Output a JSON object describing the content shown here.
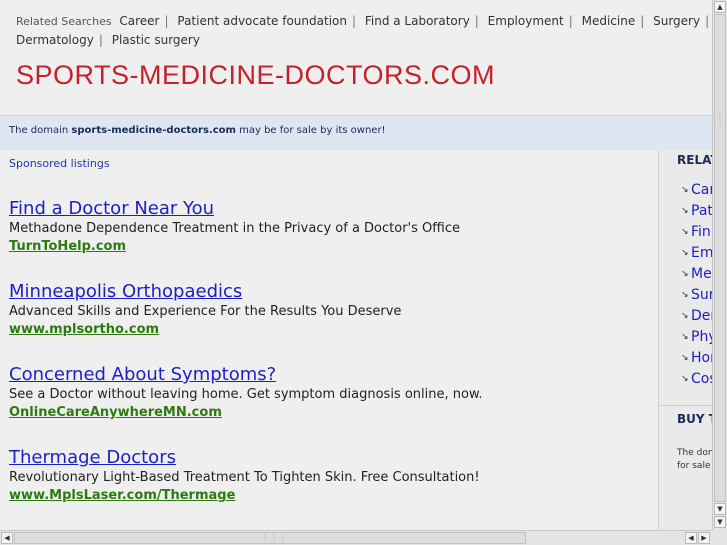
{
  "top_bar": {
    "label": "Related Searches",
    "links": [
      "Career",
      "Patient advocate foundation",
      "Find a Laboratory",
      "Employment",
      "Medicine",
      "Surgery",
      "Dermatology",
      "Plastic surgery"
    ]
  },
  "site_title": "SPORTS-MEDICINE-DOCTORS.COM",
  "sale_notice": {
    "prefix": "The domain",
    "domain": "sports-medicine-doctors.com",
    "suffix": "may be for sale by its owner!"
  },
  "sponsored_label": "Sponsored listings",
  "ads": [
    {
      "title": "Find a Doctor Near You",
      "description": "Methadone Dependence Treatment in the Privacy of a Doctor's Office",
      "url": "TurnToHelp.com"
    },
    {
      "title": "Minneapolis Orthopaedics",
      "description": "Advanced Skills and Experience For the Results You Deserve",
      "url": "www.mplsortho.com"
    },
    {
      "title": "Concerned About Symptoms?",
      "description": "See a Doctor without leaving home. Get symptom diagnosis online, now.",
      "url": "OnlineCareAnywhereMN.com"
    },
    {
      "title": "Thermage Doctors",
      "description": "Revolutionary Light-Based Treatment To Tighten Skin. Free Consultation!",
      "url": "www.MplsLaser.com/Thermage"
    }
  ],
  "right_column": {
    "heading": "RELAT",
    "items": [
      "Car",
      "Pat",
      "Fin",
      "Em",
      "Mec",
      "Sur",
      "Der",
      "Phy",
      "Hor",
      "Cos"
    ],
    "buy_heading": "BUY T",
    "buy_text_line1": "The don",
    "buy_text_line2": "for sale"
  },
  "colors": {
    "title_red": "#c8202a",
    "link_blue": "#1d1dc8",
    "url_green": "#2c7a10",
    "notice_bg": "#dde6f1"
  }
}
